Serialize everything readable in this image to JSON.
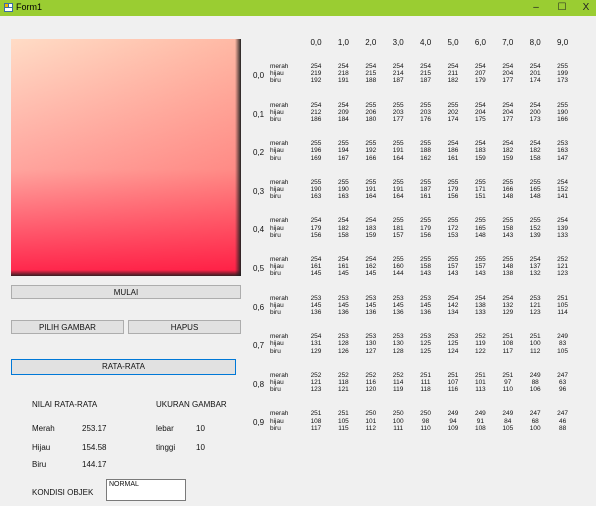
{
  "window": {
    "title": "Form1",
    "minimize_glyph": "–",
    "maximize_glyph": "☐",
    "close_glyph": "X",
    "titlebar_color": "#9acd32"
  },
  "buttons": {
    "mulai": "MULAI",
    "pilih_gambar": "PILIH GAMBAR",
    "hapus": "HAPUS",
    "rata_rata": "RATA-RATA"
  },
  "stats": {
    "nilai_heading": "NILAI RATA-RATA",
    "ukuran_heading": "UKURAN GAMBAR",
    "merah_label": "Merah",
    "merah_value": "253.17",
    "hijau_label": "Hijau",
    "hijau_value": "154.58",
    "biru_label": "Biru",
    "biru_value": "144.17",
    "lebar_label": "lebar",
    "lebar_value": "10",
    "tinggi_label": "tinggi",
    "tinggi_value": "10",
    "kondisi_label": "KONDISI OBJEK",
    "kondisi_value": "NORMAL"
  },
  "grid": {
    "col_headers": [
      "0,0",
      "1,0",
      "2,0",
      "3,0",
      "4,0",
      "5,0",
      "6,0",
      "7,0",
      "8,0",
      "9,0"
    ],
    "channel_labels": [
      "merah",
      "hijau",
      "biru"
    ],
    "rows": [
      {
        "label": "0,0",
        "merah": [
          254,
          254,
          254,
          254,
          254,
          254,
          254,
          254,
          254,
          255
        ],
        "hijau": [
          219,
          218,
          215,
          214,
          215,
          211,
          207,
          204,
          201,
          199
        ],
        "biru": [
          192,
          191,
          188,
          187,
          187,
          182,
          179,
          177,
          174,
          173
        ]
      },
      {
        "label": "0,1",
        "merah": [
          254,
          254,
          255,
          255,
          255,
          255,
          254,
          254,
          254,
          255
        ],
        "hijau": [
          212,
          209,
          206,
          203,
          203,
          202,
          204,
          204,
          200,
          190
        ],
        "biru": [
          186,
          184,
          180,
          177,
          176,
          174,
          175,
          177,
          173,
          166
        ]
      },
      {
        "label": "0,2",
        "merah": [
          255,
          255,
          255,
          255,
          255,
          254,
          254,
          254,
          254,
          253
        ],
        "hijau": [
          196,
          194,
          192,
          191,
          188,
          186,
          183,
          182,
          182,
          163
        ],
        "biru": [
          169,
          167,
          166,
          164,
          162,
          161,
          159,
          159,
          158,
          147
        ]
      },
      {
        "label": "0,3",
        "merah": [
          255,
          255,
          255,
          255,
          255,
          255,
          255,
          255,
          255,
          254
        ],
        "hijau": [
          190,
          190,
          191,
          191,
          187,
          179,
          171,
          166,
          165,
          152
        ],
        "biru": [
          163,
          163,
          164,
          164,
          161,
          156,
          151,
          148,
          148,
          141
        ]
      },
      {
        "label": "0,4",
        "merah": [
          254,
          254,
          254,
          255,
          255,
          255,
          255,
          255,
          255,
          254
        ],
        "hijau": [
          179,
          182,
          183,
          181,
          179,
          172,
          165,
          158,
          152,
          139
        ],
        "biru": [
          156,
          158,
          159,
          157,
          156,
          153,
          148,
          143,
          139,
          133
        ]
      },
      {
        "label": "0,5",
        "merah": [
          254,
          254,
          254,
          255,
          255,
          255,
          255,
          255,
          254,
          252
        ],
        "hijau": [
          161,
          161,
          162,
          160,
          158,
          157,
          157,
          148,
          137,
          121
        ],
        "biru": [
          145,
          145,
          145,
          144,
          143,
          143,
          143,
          138,
          132,
          123
        ]
      },
      {
        "label": "0,6",
        "merah": [
          253,
          253,
          253,
          253,
          253,
          254,
          254,
          254,
          253,
          251
        ],
        "hijau": [
          145,
          145,
          145,
          145,
          145,
          142,
          138,
          132,
          121,
          105
        ],
        "biru": [
          136,
          136,
          136,
          136,
          136,
          134,
          133,
          129,
          123,
          114
        ]
      },
      {
        "label": "0,7",
        "merah": [
          254,
          253,
          253,
          253,
          253,
          253,
          252,
          251,
          251,
          249
        ],
        "hijau": [
          131,
          128,
          130,
          130,
          125,
          125,
          119,
          108,
          100,
          83
        ],
        "biru": [
          129,
          126,
          127,
          128,
          125,
          124,
          122,
          117,
          112,
          105
        ]
      },
      {
        "label": "0,8",
        "merah": [
          252,
          252,
          252,
          252,
          251,
          251,
          251,
          251,
          249,
          247
        ],
        "hijau": [
          121,
          118,
          116,
          114,
          111,
          107,
          101,
          97,
          88,
          63
        ],
        "biru": [
          123,
          121,
          120,
          119,
          118,
          116,
          113,
          110,
          106,
          96
        ]
      },
      {
        "label": "0,9",
        "merah": [
          251,
          251,
          250,
          250,
          250,
          249,
          249,
          249,
          247,
          247
        ],
        "hijau": [
          108,
          105,
          101,
          100,
          98,
          94,
          91,
          84,
          68,
          46
        ],
        "biru": [
          117,
          115,
          112,
          111,
          110,
          109,
          108,
          105,
          100,
          88
        ]
      }
    ]
  }
}
